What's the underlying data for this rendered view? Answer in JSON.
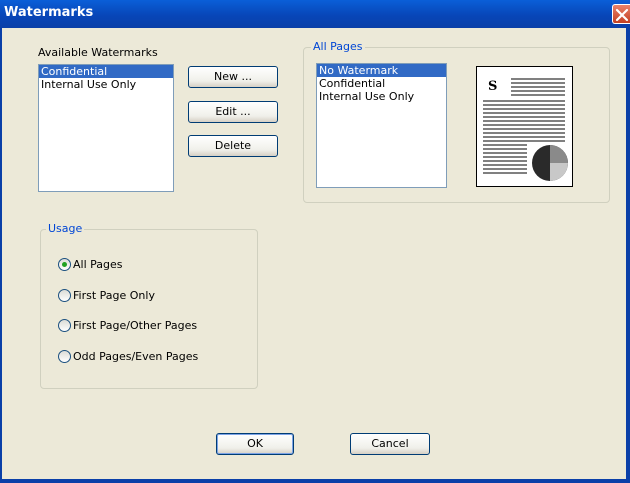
{
  "window": {
    "title": "Watermarks"
  },
  "available": {
    "label": "Available Watermarks",
    "items": [
      "Confidential",
      "Internal Use Only"
    ],
    "selected_index": 0
  },
  "actions": {
    "new_label": "New ...",
    "edit_label": "Edit ...",
    "delete_label": "Delete"
  },
  "all_pages": {
    "title": "All Pages",
    "items": [
      "No Watermark",
      "Confidential",
      "Internal Use Only"
    ],
    "selected_index": 0,
    "preview_letter": "S"
  },
  "usage": {
    "title": "Usage",
    "options": [
      "All Pages",
      "First Page Only",
      "First Page/Other Pages",
      "Odd Pages/Even Pages"
    ],
    "selected_index": 0
  },
  "footer": {
    "ok_label": "OK",
    "cancel_label": "Cancel"
  },
  "colors": {
    "title_bar": "#0a5fd8",
    "selection": "#316ac5",
    "group_title": "#0046d5",
    "radio_dot": "#21a121"
  }
}
